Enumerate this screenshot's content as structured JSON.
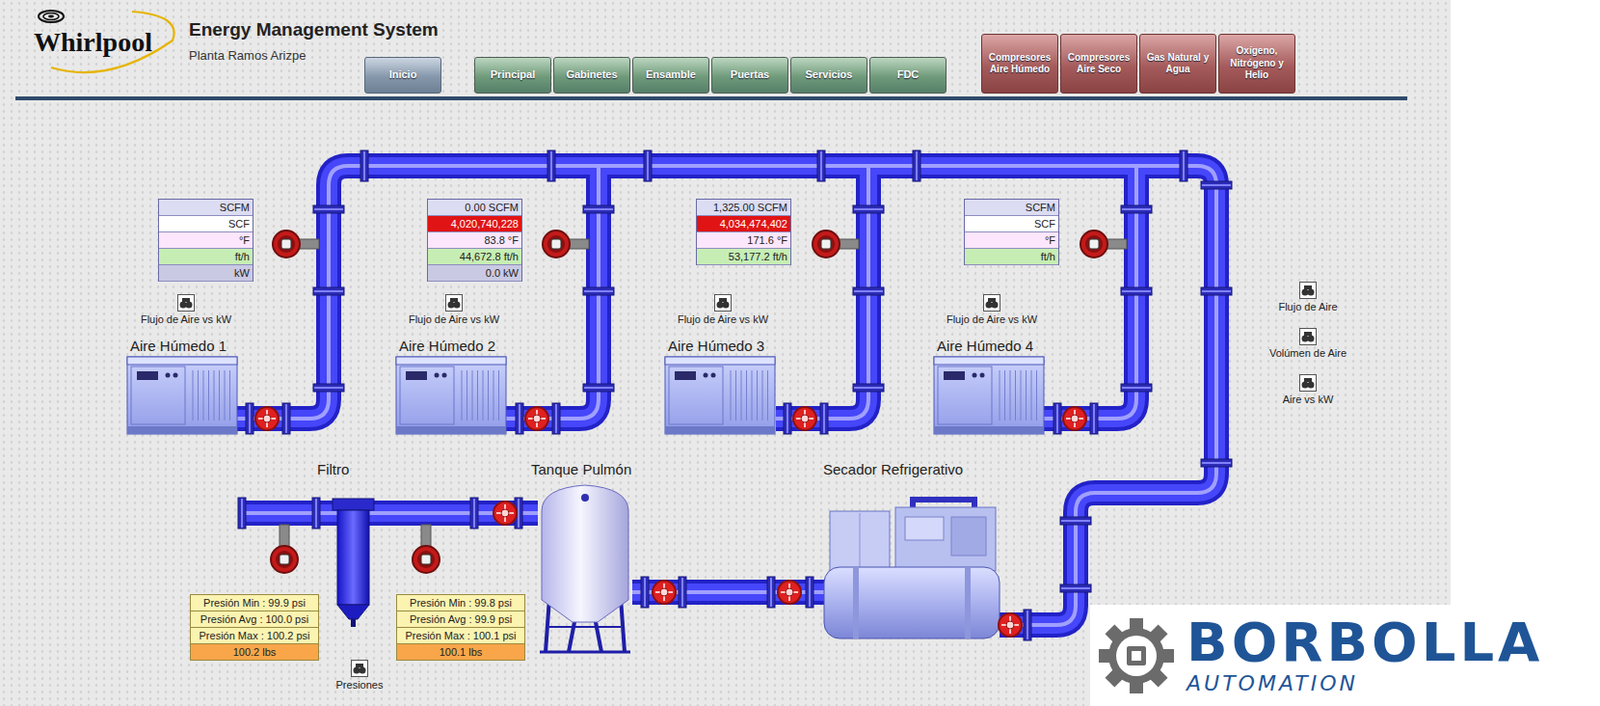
{
  "header": {
    "logo": "Whirlpool",
    "title": "Energy Management System",
    "subtitle": "Planta Ramos Arizpe"
  },
  "nav": [
    {
      "label": "Inicio",
      "kind": "home",
      "selected": false
    },
    {
      "label": "Principal",
      "kind": "area",
      "selected": false
    },
    {
      "label": "Gabinetes",
      "kind": "area",
      "selected": false
    },
    {
      "label": "Ensamble",
      "kind": "area",
      "selected": false
    },
    {
      "label": "Puertas",
      "kind": "area",
      "selected": false
    },
    {
      "label": "Servicios",
      "kind": "area",
      "selected": false
    },
    {
      "label": "FDC",
      "kind": "area",
      "selected": false
    },
    {
      "label": "Compresores Aire Húmedo",
      "kind": "utility",
      "selected": false
    },
    {
      "label": "Compresores Aire Seco",
      "kind": "utility",
      "selected": false
    },
    {
      "label": "Gas Natural y Agua",
      "kind": "utility",
      "selected": false
    },
    {
      "label": "Oxígeno, Nitrógeno y Helio",
      "kind": "utility",
      "selected": false
    }
  ],
  "compressors": [
    {
      "name": "Aire Húmedo 1",
      "chart_link": "Flujo de Aire vs kW",
      "readings": [
        {
          "kind": "flow",
          "text": "SCFM",
          "alarm": false
        },
        {
          "kind": "volume",
          "text": "SCF",
          "alarm": false
        },
        {
          "kind": "temp",
          "text": "°F",
          "alarm": false
        },
        {
          "kind": "rate",
          "text": "ft/h",
          "alarm": false
        },
        {
          "kind": "power",
          "text": "kW",
          "alarm": false
        }
      ]
    },
    {
      "name": "Aire Húmedo 2",
      "chart_link": "Flujo de Aire vs kW",
      "readings": [
        {
          "kind": "flow",
          "text": "0.00 SCFM",
          "alarm": false
        },
        {
          "kind": "volume",
          "text": "4,020,740,228",
          "alarm": true
        },
        {
          "kind": "temp",
          "text": "83.8 °F",
          "alarm": false
        },
        {
          "kind": "rate",
          "text": "44,672.8 ft/h",
          "alarm": false
        },
        {
          "kind": "power",
          "text": "0.0 kW",
          "alarm": false
        }
      ]
    },
    {
      "name": "Aire Húmedo 3",
      "chart_link": "Flujo de Aire vs kW",
      "readings": [
        {
          "kind": "flow",
          "text": "1,325.00 SCFM",
          "alarm": false
        },
        {
          "kind": "volume",
          "text": "4,034,474,402",
          "alarm": true
        },
        {
          "kind": "temp",
          "text": "171.6 °F",
          "alarm": false
        },
        {
          "kind": "rate",
          "text": "53,177.2 ft/h",
          "alarm": false
        }
      ]
    },
    {
      "name": "Aire Húmedo 4",
      "chart_link": "Flujo de Aire vs kW",
      "readings": [
        {
          "kind": "flow",
          "text": "SCFM",
          "alarm": false
        },
        {
          "kind": "volume",
          "text": "SCF",
          "alarm": false
        },
        {
          "kind": "temp",
          "text": "°F",
          "alarm": false
        },
        {
          "kind": "rate",
          "text": "ft/h",
          "alarm": false
        }
      ]
    }
  ],
  "side_links": [
    {
      "label": "Flujo de Aire"
    },
    {
      "label": "Volúmen de Aire"
    },
    {
      "label": "Aire vs kW"
    }
  ],
  "equipment": {
    "filter": "Filtro",
    "tank": "Tanque Pulmón",
    "dryer": "Secador Refrigerativo"
  },
  "pressure_panels": [
    {
      "rows": [
        "Presión Min : 99.9 psi",
        "Presión Avg : 100.0 psi",
        "Presión Max : 100.2 psi"
      ],
      "total": "100.2 lbs"
    },
    {
      "rows": [
        "Presión Min : 99.8 psi",
        "Presión Avg : 99.9 psi",
        "Presión Max : 100.1 psi"
      ],
      "total": "100.1 lbs"
    }
  ],
  "pressure_link": "Presiones",
  "brand": {
    "name": "BORBOLLA",
    "tagline": "AUTOMATION"
  }
}
